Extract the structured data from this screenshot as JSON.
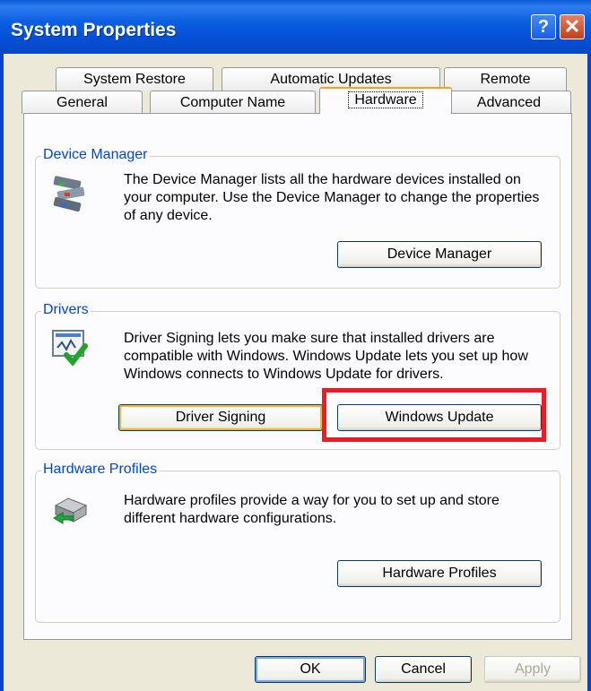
{
  "window": {
    "title": "System Properties",
    "help": "?",
    "close": "✕"
  },
  "tabs_top": [
    {
      "label": "System Restore"
    },
    {
      "label": "Automatic Updates"
    },
    {
      "label": "Remote"
    }
  ],
  "tabs_bottom": [
    {
      "label": "General"
    },
    {
      "label": "Computer Name"
    },
    {
      "label": "Hardware",
      "active": true
    },
    {
      "label": "Advanced"
    }
  ],
  "device_manager": {
    "legend": "Device Manager",
    "text": "The Device Manager lists all the hardware devices installed on your computer. Use the Device Manager to change the properties of any device.",
    "button_label": "Device Manager",
    "icon": "device-manager-icon"
  },
  "drivers": {
    "legend": "Drivers",
    "text": "Driver Signing lets you make sure that installed drivers are compatible with Windows. Windows Update lets you set up how Windows connects to Windows Update for drivers.",
    "signing_label": "Driver Signing",
    "update_label": "Windows Update",
    "icon": "driver-signing-icon"
  },
  "hardware_profiles": {
    "legend": "Hardware Profiles",
    "text": "Hardware profiles provide a way for you to set up and store different hardware configurations.",
    "button_label": "Hardware Profiles",
    "icon": "hardware-profiles-icon"
  },
  "footer": {
    "ok": "OK",
    "cancel": "Cancel",
    "apply": "Apply"
  },
  "colors": {
    "title_blue": "#0b5fe0",
    "group_label": "#0046d5",
    "highlight": "#ec1c24",
    "active_tab": "#f2a21c"
  }
}
